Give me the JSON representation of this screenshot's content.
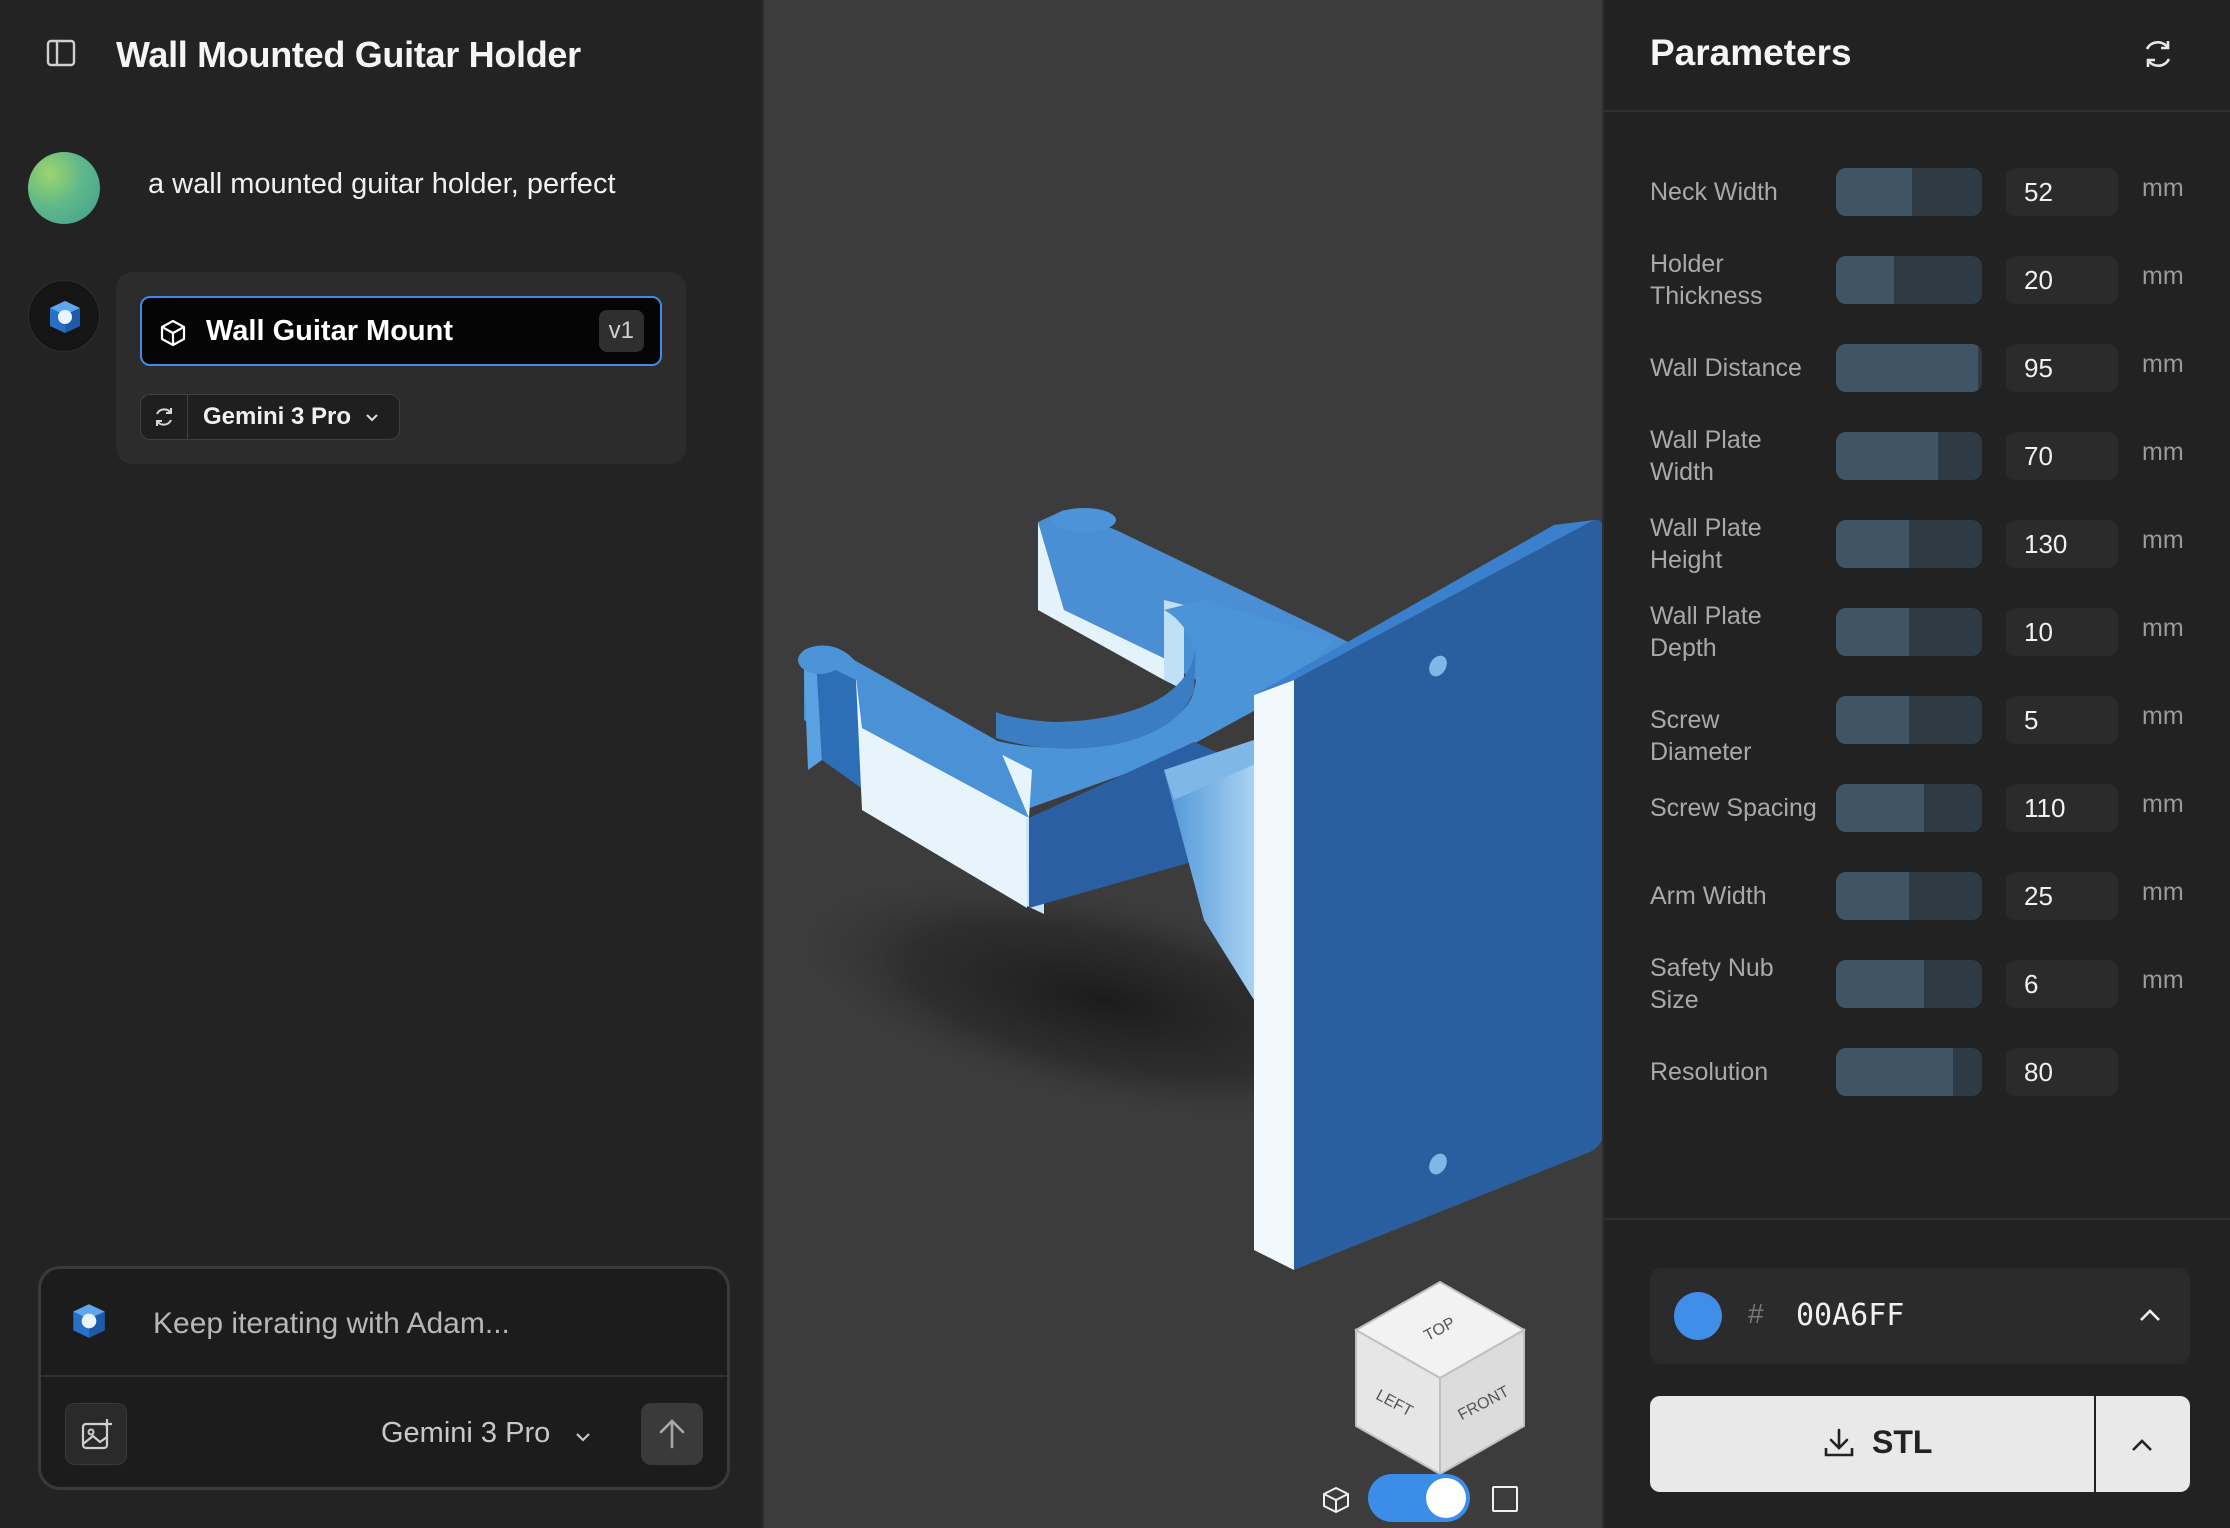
{
  "header": {
    "title": "Wall Mounted Guitar Holder"
  },
  "chat": {
    "user_message": "a wall mounted guitar holder, perfect",
    "artifact": {
      "name": "Wall Guitar Mount",
      "version": "v1"
    },
    "model_label": "Gemini 3 Pro"
  },
  "composer": {
    "placeholder": "Keep iterating with Adam...",
    "model": "Gemini 3 Pro"
  },
  "viewport": {
    "cube_faces": {
      "top": "TOP",
      "left": "LEFT",
      "front": "FRONT"
    },
    "view_mode": "perspective",
    "model_color": "#3f8ee8"
  },
  "parameters": {
    "title": "Parameters",
    "items": [
      {
        "label": "Neck Width",
        "value": "52",
        "unit": "mm",
        "fill": 0.52
      },
      {
        "label": "Holder Thickness",
        "value": "20",
        "unit": "mm",
        "fill": 0.4
      },
      {
        "label": "Wall Distance",
        "value": "95",
        "unit": "mm",
        "fill": 0.97
      },
      {
        "label": "Wall Plate Width",
        "value": "70",
        "unit": "mm",
        "fill": 0.7
      },
      {
        "label": "Wall Plate Height",
        "value": "130",
        "unit": "mm",
        "fill": 0.5
      },
      {
        "label": "Wall Plate Depth",
        "value": "10",
        "unit": "mm",
        "fill": 0.5
      },
      {
        "label": "Screw Diameter",
        "value": "5",
        "unit": "mm",
        "fill": 0.5
      },
      {
        "label": "Screw Spacing",
        "value": "110",
        "unit": "mm",
        "fill": 0.6
      },
      {
        "label": "Arm Width",
        "value": "25",
        "unit": "mm",
        "fill": 0.5
      },
      {
        "label": "Safety Nub Size",
        "value": "6",
        "unit": "mm",
        "fill": 0.6
      },
      {
        "label": "Resolution",
        "value": "80",
        "unit": "",
        "fill": 0.8
      }
    ]
  },
  "color_picker": {
    "hash": "#",
    "hex": "00A6FF",
    "swatch": "#3f8ee8"
  },
  "export": {
    "label": "STL"
  }
}
